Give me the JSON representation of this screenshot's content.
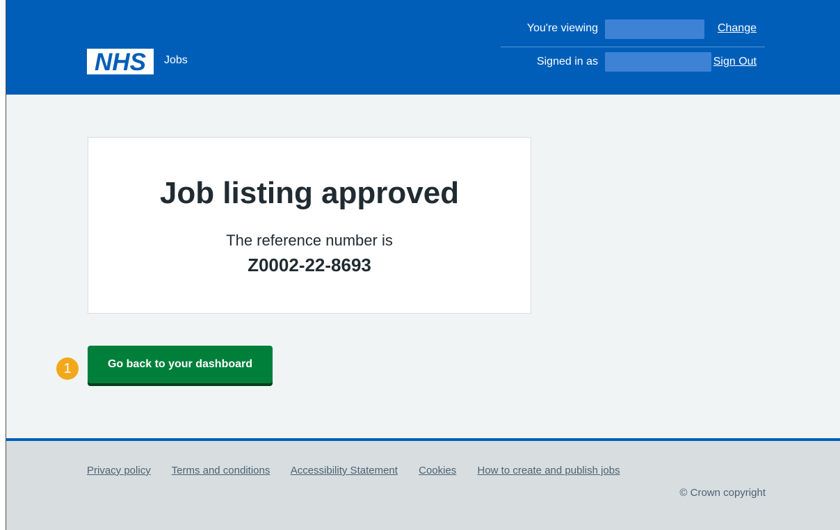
{
  "header": {
    "logo_text": "NHS",
    "service_name": "Jobs",
    "viewing_label": "You're viewing",
    "change_link": "Change",
    "signed_in_label": "Signed in as",
    "sign_out_link": "Sign Out"
  },
  "panel": {
    "title": "Job listing approved",
    "reference_label": "The reference number is",
    "reference_number": "Z0002-22-8693"
  },
  "actions": {
    "callout_number": "1",
    "dashboard_button": "Go back to your dashboard"
  },
  "footer": {
    "links": [
      "Privacy policy",
      "Terms and conditions",
      "Accessibility Statement",
      "Cookies",
      "How to create and publish jobs"
    ],
    "copyright": "© Crown copyright"
  },
  "colors": {
    "header_bg": "#005eb8",
    "button_bg": "#007f3b",
    "callout_bg": "#f3a81b",
    "page_bg": "#f0f4f5",
    "footer_bg": "#d8dde0"
  }
}
